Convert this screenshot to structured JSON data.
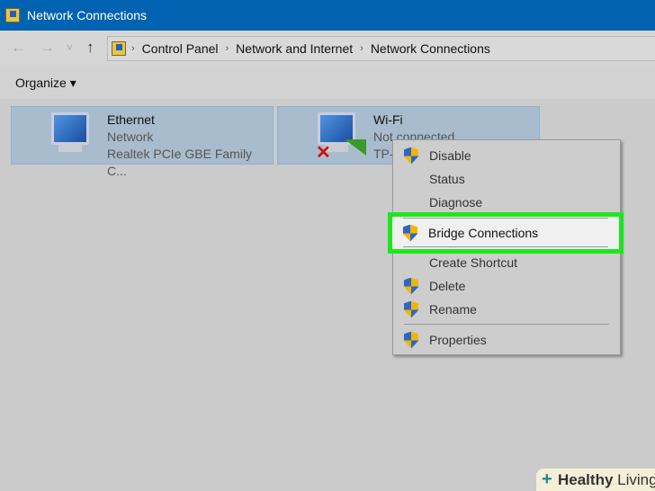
{
  "window": {
    "title": "Network Connections"
  },
  "nav": {
    "back": "←",
    "forward": "→",
    "recent": "˅",
    "up": "↑"
  },
  "breadcrumb": [
    "Control Panel",
    "Network and Internet",
    "Network Connections"
  ],
  "toolbar": {
    "organize": "Organize ▾"
  },
  "connections": [
    {
      "name": "Ethernet",
      "status": "Network",
      "device": "Realtek PCIe GBE Family C..."
    },
    {
      "name": "Wi-Fi",
      "status": "Not connected",
      "device": "TP-"
    }
  ],
  "context_menu": {
    "items": [
      {
        "label": "Disable",
        "shield": true
      },
      {
        "label": "Status",
        "shield": false
      },
      {
        "label": "Diagnose",
        "shield": false
      },
      {
        "label": "Bridge Connections",
        "shield": true
      },
      {
        "label": "Create Shortcut",
        "shield": false
      },
      {
        "label": "Delete",
        "shield": true
      },
      {
        "label": "Rename",
        "shield": true
      },
      {
        "label": "Properties",
        "shield": true
      }
    ]
  },
  "watermark": {
    "bold": "Healthy",
    "rest": "Living"
  },
  "colors": {
    "titlebar": "#0063b1",
    "highlight": "#1ee61e"
  }
}
